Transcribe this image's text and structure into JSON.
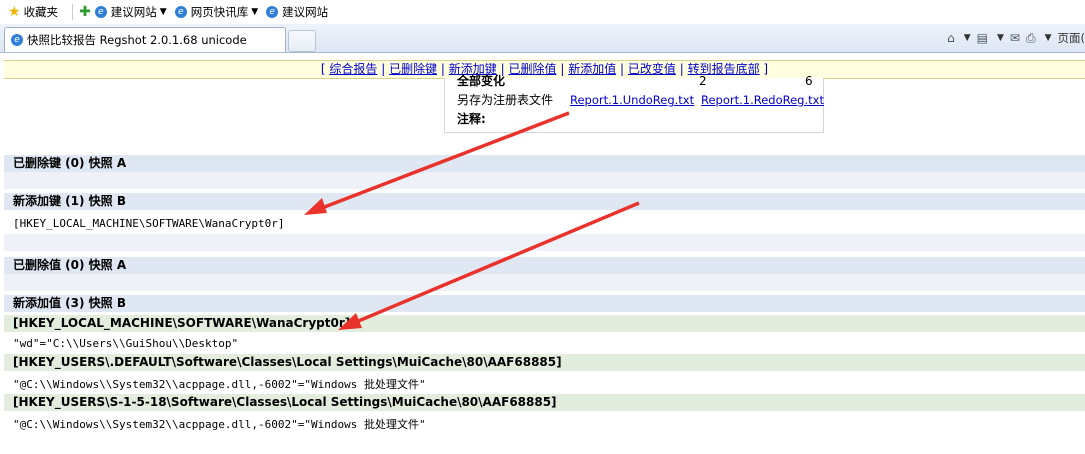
{
  "favorites_bar": {
    "favorites_label": "收藏夹",
    "items": [
      {
        "label": "建议网站",
        "dropdown": true
      },
      {
        "label": "网页快讯库",
        "dropdown": true
      },
      {
        "label": "建议网站",
        "dropdown": false
      }
    ]
  },
  "tab": {
    "title": "快照比较报告 Regshot 2.0.1.68 unicode"
  },
  "command_bar": {
    "page_label": "页面("
  },
  "nav_links": [
    "综合报告",
    "已删除键",
    "新添加键",
    "已删除值",
    "新添加值",
    "已改变值",
    "转到报告底部"
  ],
  "summary": {
    "row1": {
      "label": "全部变化",
      "value_a": "2",
      "value_b": "6"
    },
    "row2": {
      "label": "另存为注册表文件",
      "link_a": "Report.1.UndoReg.txt",
      "link_b": "Report.1.RedoReg.txt"
    },
    "row3": {
      "label": "注释:"
    }
  },
  "sections": {
    "deleted_keys": "已删除键  (0) 快照  A",
    "added_keys": "新添加键  (1) 快照  B",
    "added_key_1": "[HKEY_LOCAL_MACHINE\\SOFTWARE\\WanaCrypt0r]",
    "deleted_values": "已删除值  (0) 快照  A",
    "added_values": "新添加值  (3) 快照  B",
    "value_key_1": "[HKEY_LOCAL_MACHINE\\SOFTWARE\\WanaCrypt0r]",
    "value_1": "\"wd\"=\"C:\\\\Users\\\\GuiShou\\\\Desktop\"",
    "value_key_2": "[HKEY_USERS\\.DEFAULT\\Software\\Classes\\Local Settings\\MuiCache\\80\\AAF68885]",
    "value_2": "\"@C:\\\\Windows\\\\System32\\\\acppage.dll,-6002\"=\"Windows 批处理文件\"",
    "value_key_3": "[HKEY_USERS\\S-1-5-18\\Software\\Classes\\Local Settings\\MuiCache\\80\\AAF68885]",
    "value_3": "\"@C:\\\\Windows\\\\System32\\\\acppage.dll,-6002\"=\"Windows 批处理文件\""
  },
  "colors": {
    "section_band": "#dfe8f2",
    "key_band": "#e3eddd",
    "nav_bg": "#ffffe0",
    "link": "#0000cc",
    "arrow": "#e8322b"
  }
}
